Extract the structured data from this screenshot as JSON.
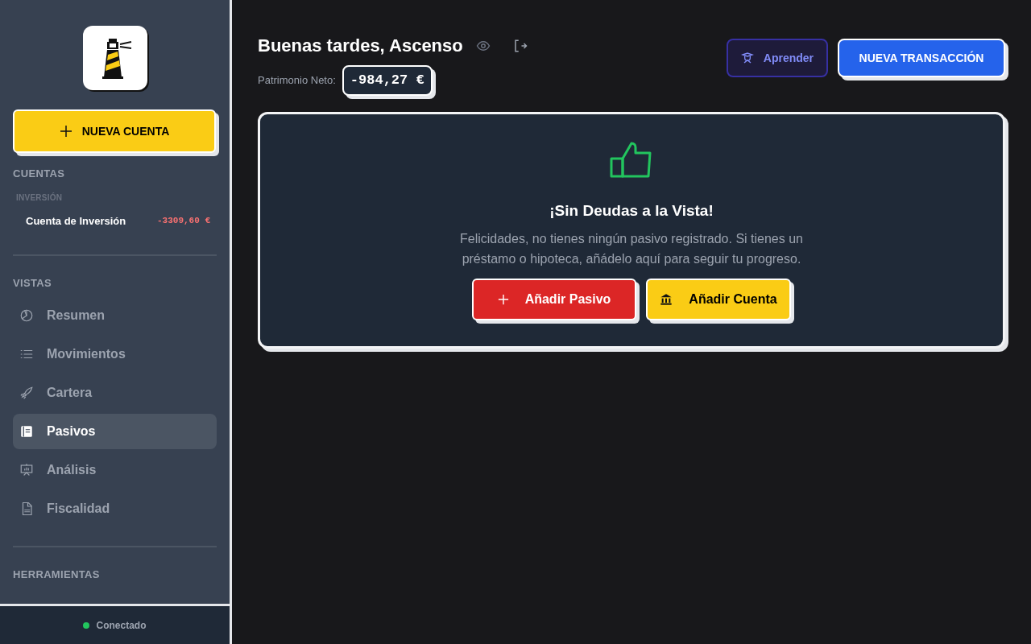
{
  "sidebar": {
    "new_account_button": "NUEVA CUENTA",
    "accounts_heading": "CUENTAS",
    "account_groups": [
      {
        "label": "INVERSIÓN",
        "accounts": [
          {
            "name": "Cuenta de Inversión",
            "balance": "-3309,60 €"
          }
        ]
      }
    ],
    "views_heading": "VISTAS",
    "items": [
      {
        "label": "Resumen",
        "selected": false
      },
      {
        "label": "Movimientos",
        "selected": false
      },
      {
        "label": "Cartera",
        "selected": false
      },
      {
        "label": "Pasivos",
        "selected": true
      },
      {
        "label": "Análisis",
        "selected": false
      },
      {
        "label": "Fiscalidad",
        "selected": false
      }
    ],
    "tools_heading": "HERRAMIENTAS",
    "status": {
      "label": "Conectado",
      "color": "#22c55e"
    }
  },
  "header": {
    "greeting": "Buenas tardes, Ascenso",
    "net_worth_label": "Patrimonio Neto:",
    "net_worth": "-984,27 €",
    "learn_button": "Aprender",
    "new_transaction_button": "NUEVA TRANSACCIÓN"
  },
  "empty_state": {
    "title": "¡Sin Deudas a la Vista!",
    "message": "Felicidades, no tienes ningún pasivo registrado. Si tienes un préstamo o hipoteca, añádelo aquí para seguir tu progreso.",
    "buttons": [
      {
        "label": "Añadir Pasivo",
        "kind": "danger"
      },
      {
        "label": "Añadir Cuenta",
        "kind": "warning"
      }
    ]
  }
}
